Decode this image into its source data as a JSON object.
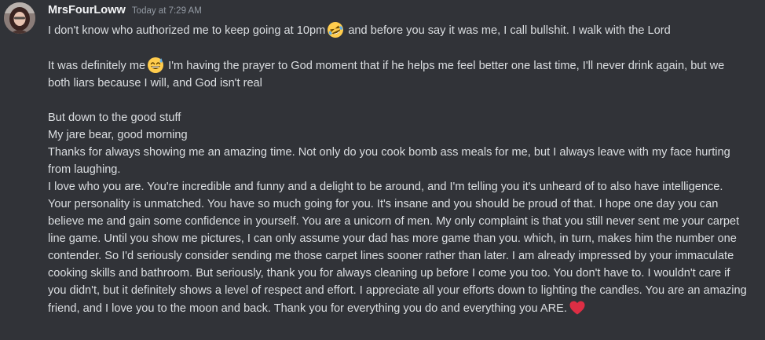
{
  "message": {
    "username": "MrsFourLoww",
    "timestamp": "Today at 7:29 AM",
    "colors": {
      "background": "#313338",
      "text": "#dbdee1",
      "username": "#f2f3f5",
      "timestamp": "#949ba4",
      "heart": "#dd2e44",
      "emoji": "#ffcc4d"
    },
    "emoji_names": [
      "rolling-on-floor-laughing",
      "grinning-sweat",
      "red-heart"
    ],
    "p1_text": "I don't know who authorized me to keep going at 10pm",
    "p1_after": " and before you say it was me, I call bullshit. I walk with the Lord",
    "p2_text": "It was definitely me",
    "p2_after": " I'm having the prayer to God moment that if he helps me feel better one last time, I'll never drink again, but we both liars because I will, and God isn't real",
    "p3_line1": "But down to the good stuff",
    "p3_line2": "My jare bear, good morning",
    "p3_line3": "Thanks for always showing me an amazing time. Not only do you cook bomb ass meals for me, but I always leave with my face hurting from laughing.",
    "p3_line4": "I love who you are. You're incredible and funny and a delight to be around, and I'm telling you it's unheard of to also have intelligence. Your personality is unmatched. You have so much going for you. It's insane and you should be proud of that. I hope one day you can believe me and gain some confidence in yourself. You are a unicorn of men. My only complaint is that you still never sent me your carpet line game. Until you show me pictures, I can only assume your dad has more game than you. which, in turn, makes him the number one contender. So I'd seriously consider sending me those carpet lines sooner rather than later. I am already impressed by your immaculate cooking skills and bathroom. But seriously, thank you for always cleaning up before I come you too. You don't have to. I wouldn't care if you didn't, but it definitely shows a level of respect and effort. I appreciate all your efforts down to lighting the candles. You are an amazing friend, and I love you to the moon and back. Thank you for everything you do and everything you ARE."
  }
}
